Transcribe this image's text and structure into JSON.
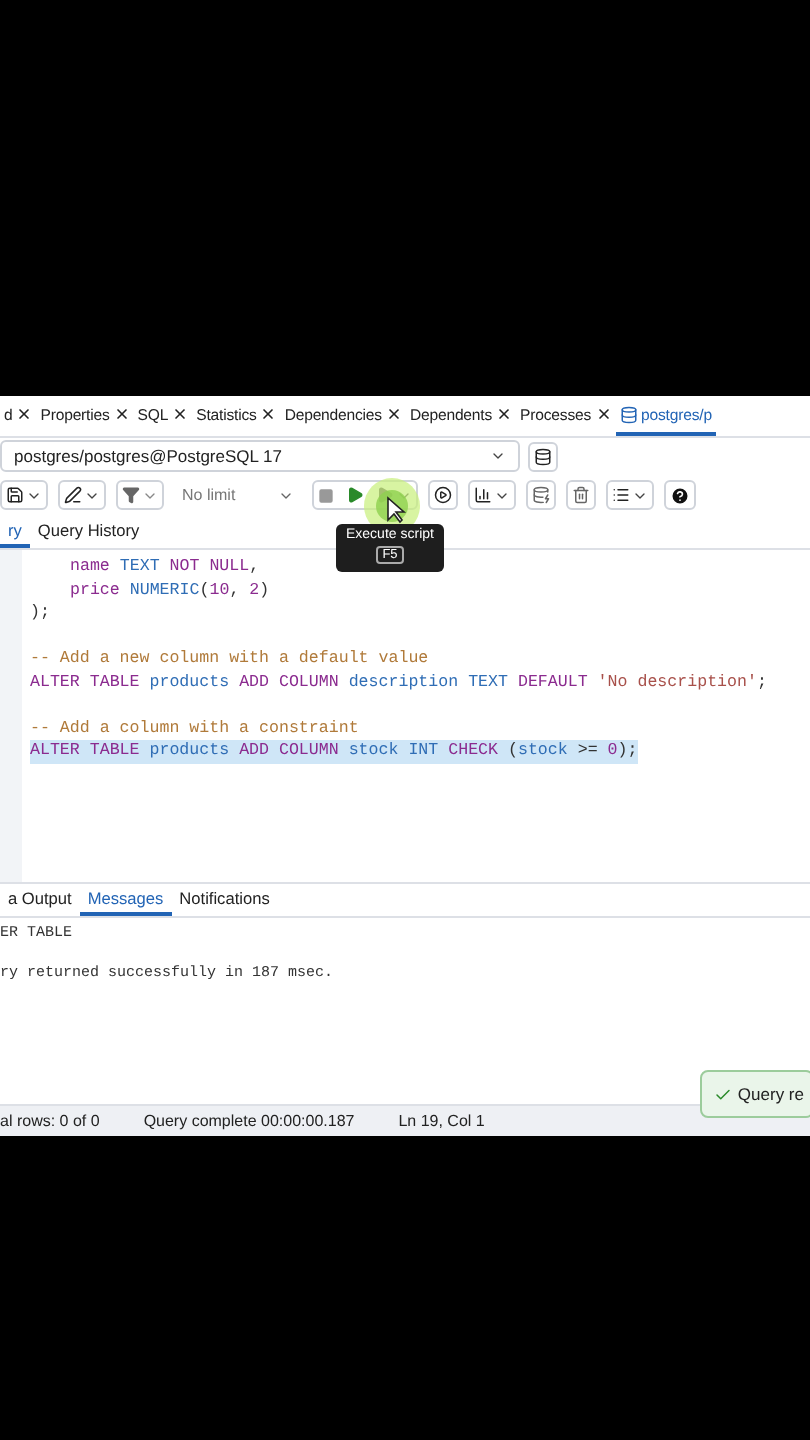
{
  "tabs": [
    {
      "label": "d",
      "selected": false,
      "kind": "panel"
    },
    {
      "label": "Properties",
      "selected": false,
      "kind": "panel"
    },
    {
      "label": "SQL",
      "selected": false,
      "kind": "panel"
    },
    {
      "label": "Statistics",
      "selected": false,
      "kind": "panel"
    },
    {
      "label": "Dependencies",
      "selected": false,
      "kind": "panel"
    },
    {
      "label": "Dependents",
      "selected": false,
      "kind": "panel"
    },
    {
      "label": "Processes",
      "selected": false,
      "kind": "panel"
    },
    {
      "label": "postgres/p",
      "selected": true,
      "kind": "query"
    }
  ],
  "connection": {
    "value": "postgres/postgres@PostgreSQL 17"
  },
  "toolbar": {
    "limit": "No limit",
    "tooltip": {
      "title": "Execute script",
      "shortcut": "F5"
    }
  },
  "query_tabs": [
    {
      "label": "ry",
      "selected": true
    },
    {
      "label": "Query History",
      "selected": false
    }
  ],
  "editor": {
    "lines": [
      {
        "kind": "code",
        "indented": true,
        "highlighted": false,
        "tokens": [
          {
            "kind": "ident",
            "text": "name"
          },
          {
            "kind": "type",
            "text": "TEXT"
          },
          {
            "kind": "keyword",
            "text": "NOT NULL"
          },
          {
            "kind": "plain",
            "text": ",",
            "attached": true
          }
        ]
      },
      {
        "kind": "code",
        "indented": true,
        "highlighted": false,
        "tokens": [
          {
            "kind": "ident",
            "text": "price"
          },
          {
            "kind": "type",
            "text": "NUMERIC"
          },
          {
            "kind": "plain",
            "text": "(",
            "attached": true
          },
          {
            "kind": "number",
            "text": "10",
            "attached": true
          },
          {
            "kind": "plain",
            "text": ",",
            "attached": true
          },
          {
            "kind": "number",
            "text": "2"
          },
          {
            "kind": "plain",
            "text": ")",
            "attached": true
          }
        ]
      },
      {
        "kind": "code",
        "highlighted": false,
        "tokens": [
          {
            "kind": "plain",
            "text": ");"
          }
        ]
      },
      {
        "kind": "blank"
      },
      {
        "kind": "code",
        "highlighted": false,
        "tokens": [
          {
            "kind": "comment",
            "text": "-- Add a new column with a default value"
          }
        ]
      },
      {
        "kind": "code",
        "highlighted": false,
        "tokens": [
          {
            "kind": "keyword",
            "text": "ALTER TABLE"
          },
          {
            "kind": "type",
            "text": "products"
          },
          {
            "kind": "keyword",
            "text": "ADD COLUMN"
          },
          {
            "kind": "type",
            "text": "description"
          },
          {
            "kind": "type",
            "text": "TEXT"
          },
          {
            "kind": "keyword",
            "text": "DEFAULT"
          },
          {
            "kind": "string",
            "text": "'No description'"
          },
          {
            "kind": "plain",
            "text": ";",
            "attached": true
          }
        ]
      },
      {
        "kind": "blank"
      },
      {
        "kind": "code",
        "highlighted": false,
        "tokens": [
          {
            "kind": "comment",
            "text": "-- Add a column with a constraint"
          }
        ]
      },
      {
        "kind": "code",
        "highlighted": true,
        "tokens": [
          {
            "kind": "keyword",
            "text": "ALTER TABLE"
          },
          {
            "kind": "type",
            "text": "products"
          },
          {
            "kind": "keyword",
            "text": "ADD COLUMN"
          },
          {
            "kind": "type",
            "text": "stock"
          },
          {
            "kind": "type",
            "text": "INT"
          },
          {
            "kind": "keyword",
            "text": "CHECK"
          },
          {
            "kind": "plain",
            "text": "("
          },
          {
            "kind": "type",
            "text": "stock",
            "attached": true
          },
          {
            "kind": "plain",
            "text": ">="
          },
          {
            "kind": "number",
            "text": "0"
          },
          {
            "kind": "plain",
            "text": ");",
            "attached": true
          }
        ]
      }
    ]
  },
  "output_tabs": [
    {
      "label": "a Output",
      "selected": false
    },
    {
      "label": "Messages",
      "selected": true
    },
    {
      "label": "Notifications",
      "selected": false
    }
  ],
  "messages": [
    "ER TABLE",
    "ry returned successfully in 187 msec."
  ],
  "toast": {
    "text": "Query re"
  },
  "status_bar": [
    "al rows: 0 of 0",
    "Query complete 00:00:00.187",
    "Ln 19, Col 1"
  ]
}
